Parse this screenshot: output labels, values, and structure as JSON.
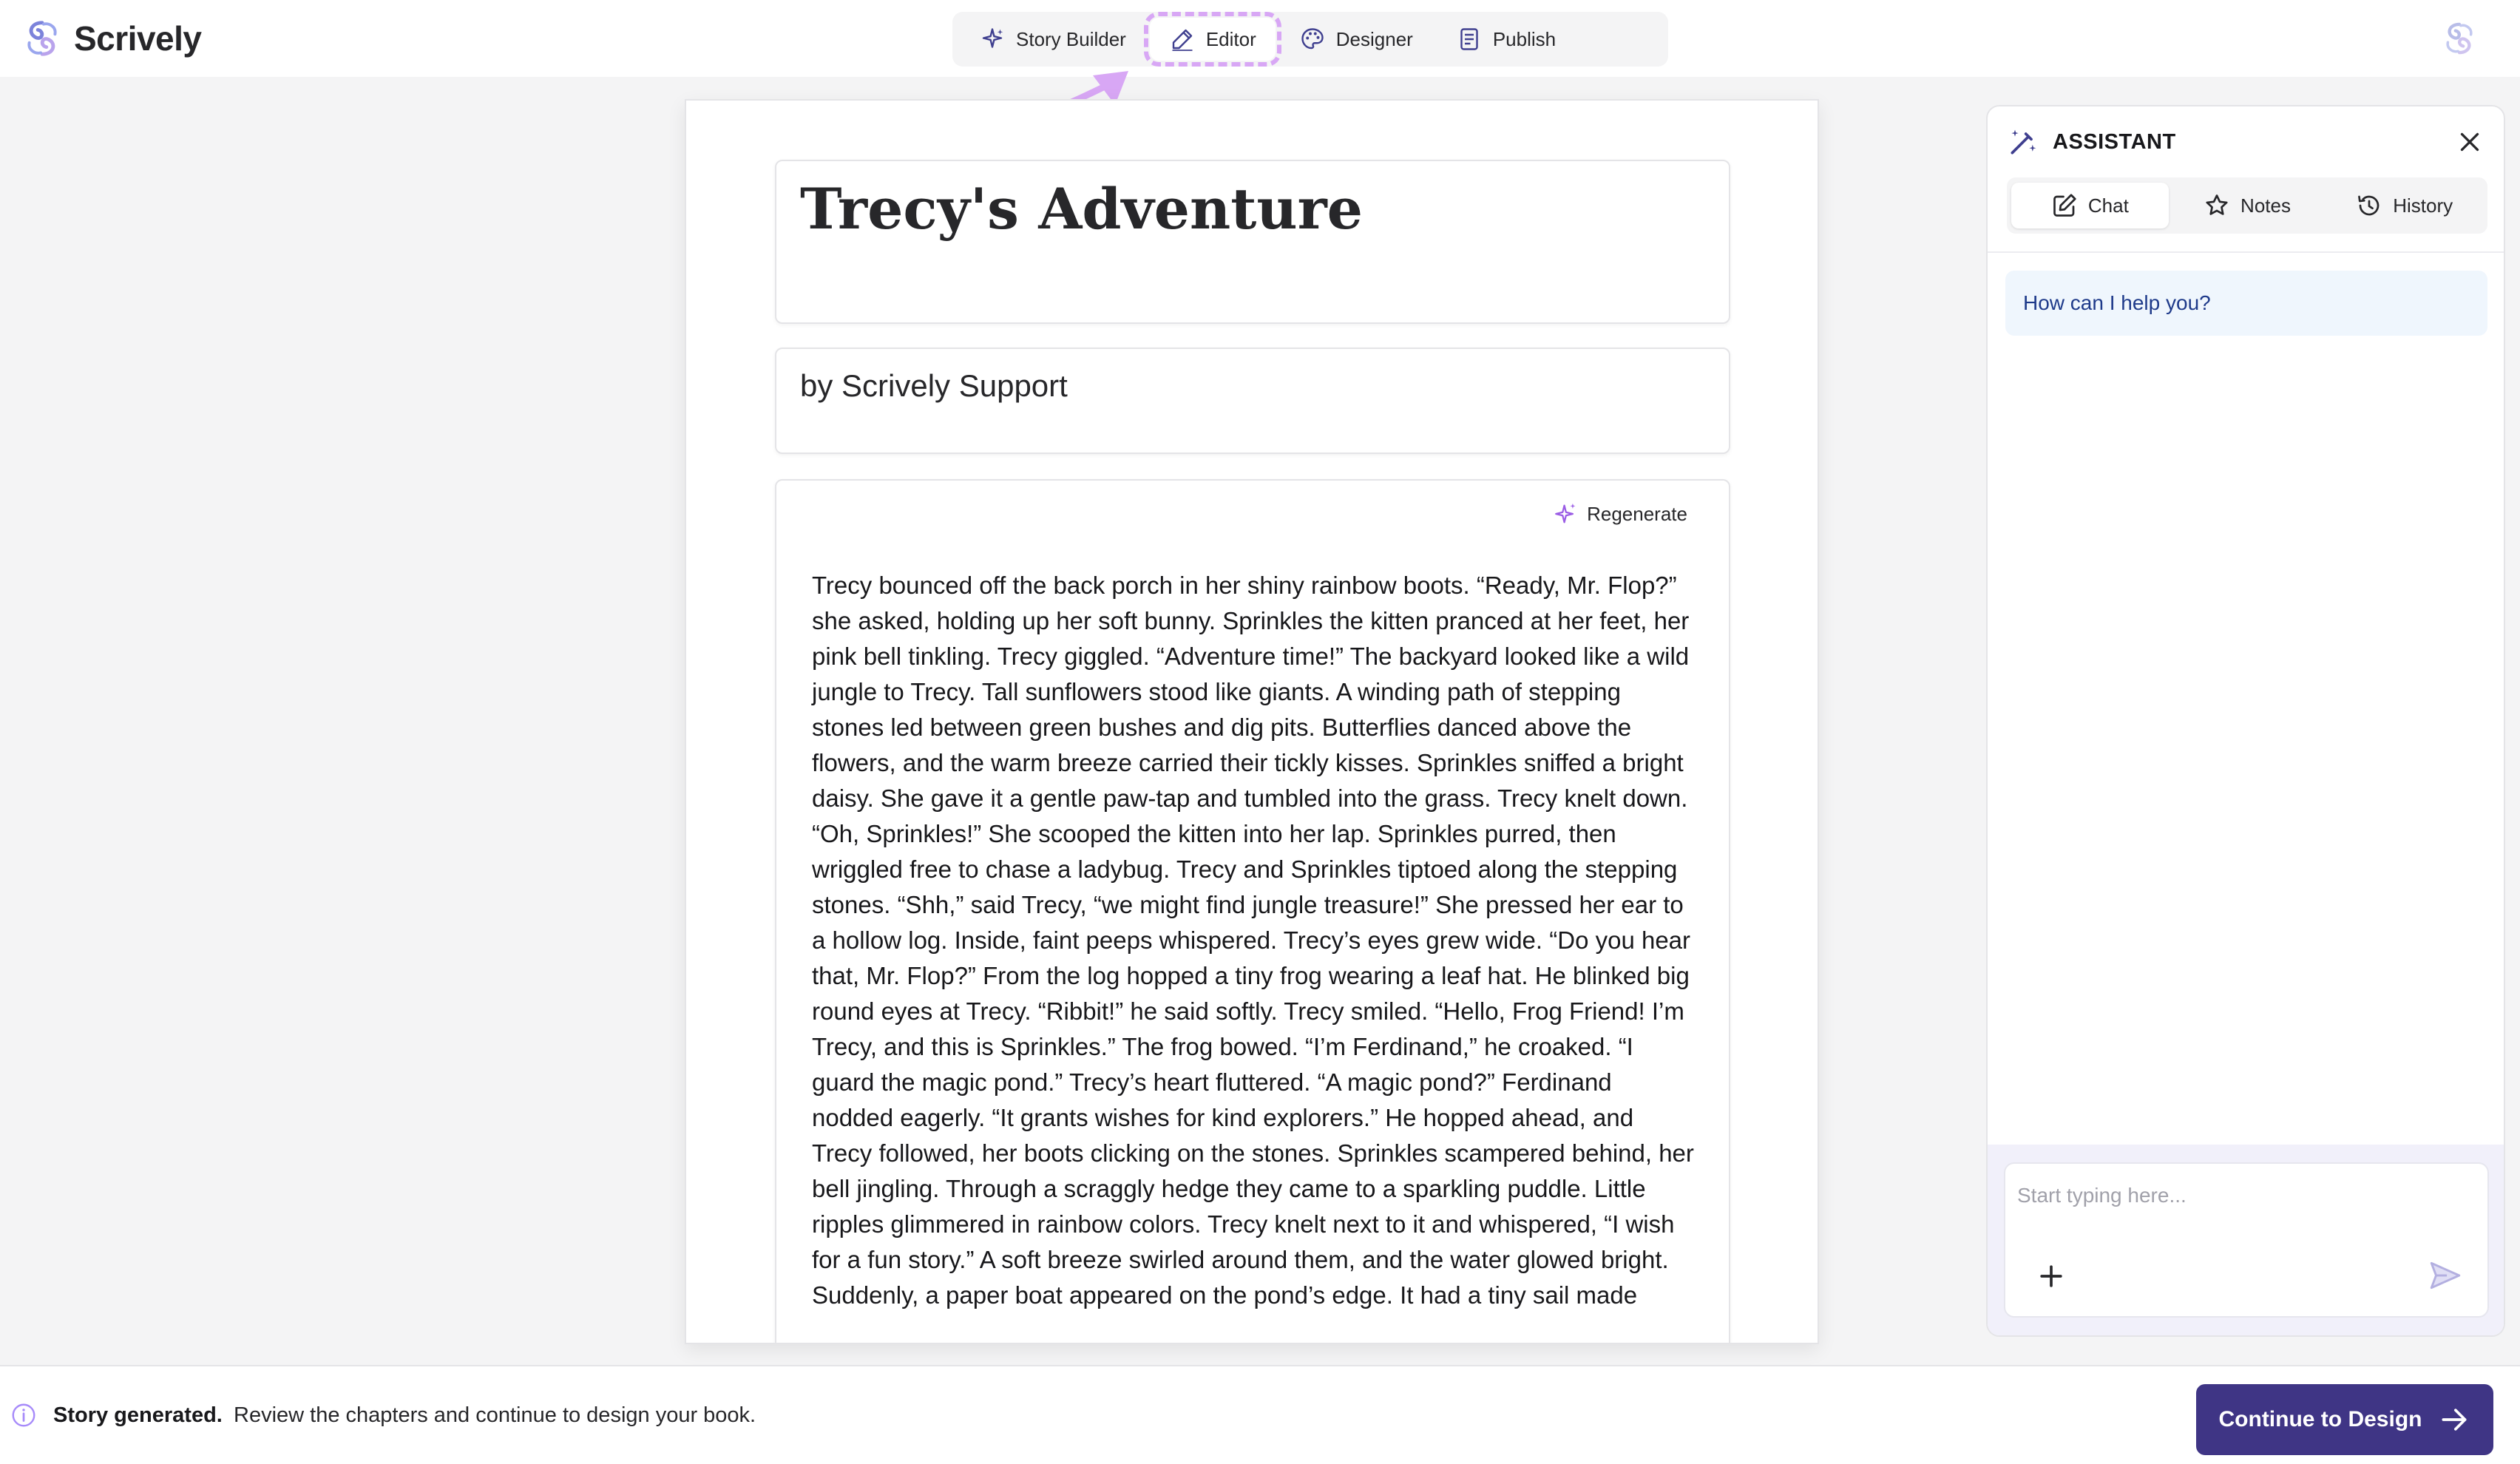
{
  "app": {
    "name": "Scrively",
    "logo_icon": "scrively-logo-icon"
  },
  "modes": [
    {
      "label": "Story Builder",
      "icon": "sparkles-icon",
      "active": false
    },
    {
      "label": "Editor",
      "icon": "pen-icon",
      "active": true
    },
    {
      "label": "Designer",
      "icon": "palette-icon",
      "active": false
    },
    {
      "label": "Publish",
      "icon": "document-icon",
      "active": false
    }
  ],
  "document": {
    "title": "Trecy's Adventure",
    "author": "by Scrively Support",
    "regenerate_label": "Regenerate",
    "body": "Trecy bounced off the back porch in her shiny rainbow boots. “Ready, Mr. Flop?” she asked, holding up her soft bunny. Sprinkles the kitten pranced at her feet, her pink bell tinkling. Trecy giggled. “Adventure time!” The backyard looked like a wild jungle to Trecy. Tall sunflowers stood like giants. A winding path of stepping stones led between green bushes and dig pits. Butterflies danced above the flowers, and the warm breeze carried their tickly kisses. Sprinkles sniffed a bright daisy. She gave it a gentle paw-tap and tumbled into the grass. Trecy knelt down. “Oh, Sprinkles!” She scooped the kitten into her lap. Sprinkles purred, then wriggled free to chase a ladybug. Trecy and Sprinkles tiptoed along the stepping stones. “Shh,” said Trecy, “we might find jungle treasure!” She pressed her ear to a hollow log. Inside, faint peeps whispered. Trecy’s eyes grew wide. “Do you hear that, Mr. Flop?” From the log hopped a tiny frog wearing a leaf hat. He blinked big round eyes at Trecy. “Ribbit!” he said softly. Trecy smiled. “Hello, Frog Friend! I’m Trecy, and this is Sprinkles.” The frog bowed. “I’m Ferdinand,” he croaked. “I guard the magic pond.” Trecy’s heart fluttered. “A magic pond?” Ferdinand nodded eagerly. “It grants wishes for kind explorers.” He hopped ahead, and Trecy followed, her boots clicking on the stones. Sprinkles scampered behind, her bell jingling. Through a scraggly hedge they came to a sparkling puddle. Little ripples glimmered in rainbow colors. Trecy knelt next to it and whispered, “I wish for a fun story.” A soft breeze swirled around them, and the water glowed bright. Suddenly, a paper boat appeared on the pond’s edge. It had a tiny sail made"
  },
  "assistant": {
    "title": "ASSISTANT",
    "tabs": [
      {
        "label": "Chat",
        "icon": "edit-icon",
        "active": true
      },
      {
        "label": "Notes",
        "icon": "star-icon",
        "active": false
      },
      {
        "label": "History",
        "icon": "history-icon",
        "active": false
      }
    ],
    "greeting": "How can I help you?",
    "input_placeholder": "Start typing here...",
    "input_value": ""
  },
  "status": {
    "strong": "Story generated.",
    "text": "Review the chapters and continue to design your book.",
    "cta_label": "Continue to Design"
  },
  "colors": {
    "accent": "#3f3585",
    "highlight": "#d8a7f5",
    "bubble_bg": "#eff6fd"
  }
}
